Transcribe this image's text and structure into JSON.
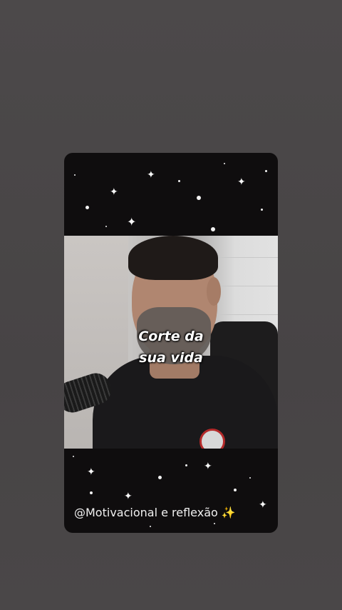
{
  "video": {
    "caption_line1": "Corte da",
    "caption_line2": "sua vida"
  },
  "footer": {
    "handle_text": "@Motivacional e reflexão",
    "sparkles_emoji": "✨"
  },
  "colors": {
    "background": "#4a4748",
    "card": "#0f0d0e",
    "caption": "#ffffff"
  }
}
